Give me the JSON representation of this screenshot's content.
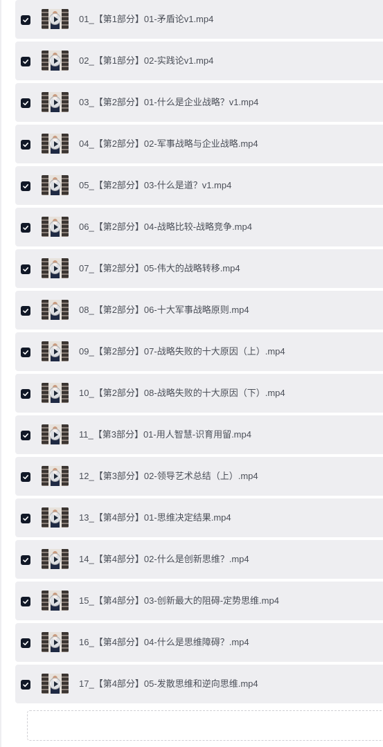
{
  "files": [
    {
      "name": "01_【第1部分】01-矛盾论v1.mp4",
      "checked": true,
      "thumbnail_icon": "video-thumbnail-icon"
    },
    {
      "name": "02_【第1部分】02-实践论v1.mp4",
      "checked": true,
      "thumbnail_icon": "video-thumbnail-icon"
    },
    {
      "name": "03_【第2部分】01-什么是企业战略？v1.mp4",
      "checked": true,
      "thumbnail_icon": "video-thumbnail-icon"
    },
    {
      "name": "04_【第2部分】02-军事战略与企业战略.mp4",
      "checked": true,
      "thumbnail_icon": "video-thumbnail-icon"
    },
    {
      "name": "05_【第2部分】03-什么是道？v1.mp4",
      "checked": true,
      "thumbnail_icon": "video-thumbnail-icon"
    },
    {
      "name": "06_【第2部分】04-战略比较-战略竞争.mp4",
      "checked": true,
      "thumbnail_icon": "video-thumbnail-icon"
    },
    {
      "name": "07_【第2部分】05-伟大的战略转移.mp4",
      "checked": true,
      "thumbnail_icon": "video-thumbnail-icon"
    },
    {
      "name": "08_【第2部分】06-十大军事战略原则.mp4",
      "checked": true,
      "thumbnail_icon": "video-thumbnail-icon"
    },
    {
      "name": "09_【第2部分】07-战略失败的十大原因（上）.mp4",
      "checked": true,
      "thumbnail_icon": "video-thumbnail-icon"
    },
    {
      "name": "10_【第2部分】08-战略失败的十大原因（下）.mp4",
      "checked": true,
      "thumbnail_icon": "video-thumbnail-icon"
    },
    {
      "name": "11_【第3部分】01-用人智慧-识育用留.mp4",
      "checked": true,
      "thumbnail_icon": "video-thumbnail-icon"
    },
    {
      "name": "12_【第3部分】02-领导艺术总结（上）.mp4",
      "checked": true,
      "thumbnail_icon": "video-thumbnail-icon"
    },
    {
      "name": "13_【第4部分】01-思维决定结果.mp4",
      "checked": true,
      "thumbnail_icon": "video-thumbnail-icon"
    },
    {
      "name": "14_【第4部分】02-什么是创新思维？.mp4",
      "checked": true,
      "thumbnail_icon": "video-thumbnail-icon"
    },
    {
      "name": "15_【第4部分】03-创新最大的阻碍-定势思维.mp4",
      "checked": true,
      "thumbnail_icon": "video-thumbnail-icon"
    },
    {
      "name": "16_【第4部分】04-什么是思维障碍？.mp4",
      "checked": true,
      "thumbnail_icon": "video-thumbnail-icon"
    },
    {
      "name": "17_【第4部分】05-发散思维和逆向思维.mp4",
      "checked": true,
      "thumbnail_icon": "video-thumbnail-icon"
    }
  ],
  "colors": {
    "row_background": "#eeeef1",
    "checkbox_fill": "#111827",
    "text": "#4b4f58"
  }
}
